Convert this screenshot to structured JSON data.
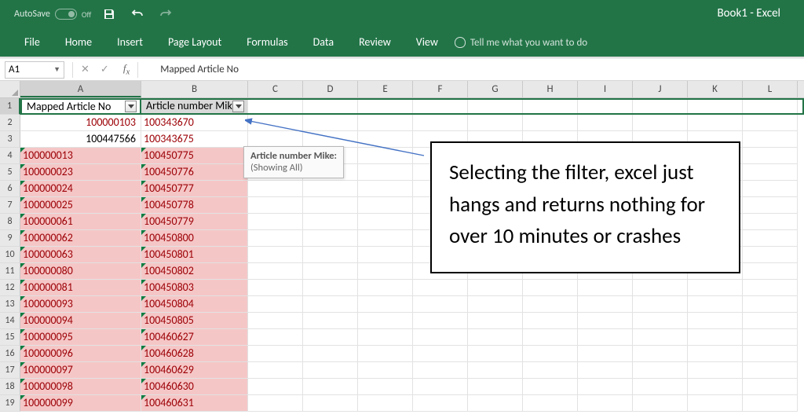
{
  "titlebar": {
    "autosave_label": "AutoSave",
    "autosave_state": "Off",
    "title": "Book1  -  Excel"
  },
  "tabs": [
    "File",
    "Home",
    "Insert",
    "Page Layout",
    "Formulas",
    "Data",
    "Review",
    "View"
  ],
  "tellme": "Tell me what you want to do",
  "namebox": "A1",
  "formula": "Mapped Article No",
  "columns": [
    "A",
    "B",
    "C",
    "D",
    "E",
    "F",
    "G",
    "H",
    "I",
    "J",
    "K",
    "L"
  ],
  "header_row": {
    "a": "Mapped Article No",
    "b": "Article number Mik"
  },
  "rows": [
    {
      "n": 2,
      "a": "100000103",
      "b": "100343670",
      "apink": false,
      "bpink": false
    },
    {
      "n": 3,
      "a": "100447566",
      "b": "100343675",
      "apink": false,
      "bpink": false,
      "ablack": true
    },
    {
      "n": 4,
      "a": "100000013",
      "b": "100450775",
      "apink": true,
      "bpink": true
    },
    {
      "n": 5,
      "a": "100000023",
      "b": "100450776",
      "apink": true,
      "bpink": true
    },
    {
      "n": 6,
      "a": "100000024",
      "b": "100450777",
      "apink": true,
      "bpink": true
    },
    {
      "n": 7,
      "a": "100000025",
      "b": "100450778",
      "apink": true,
      "bpink": true
    },
    {
      "n": 8,
      "a": "100000061",
      "b": "100450779",
      "apink": true,
      "bpink": true
    },
    {
      "n": 9,
      "a": "100000062",
      "b": "100450800",
      "apink": true,
      "bpink": true
    },
    {
      "n": 10,
      "a": "100000063",
      "b": "100450801",
      "apink": true,
      "bpink": true
    },
    {
      "n": 11,
      "a": "100000080",
      "b": "100450802",
      "apink": true,
      "bpink": true
    },
    {
      "n": 12,
      "a": "100000081",
      "b": "100450803",
      "apink": true,
      "bpink": true
    },
    {
      "n": 13,
      "a": "100000093",
      "b": "100450804",
      "apink": true,
      "bpink": true
    },
    {
      "n": 14,
      "a": "100000094",
      "b": "100450805",
      "apink": true,
      "bpink": true
    },
    {
      "n": 15,
      "a": "100000095",
      "b": "100460627",
      "apink": true,
      "bpink": true
    },
    {
      "n": 16,
      "a": "100000096",
      "b": "100460628",
      "apink": true,
      "bpink": true
    },
    {
      "n": 17,
      "a": "100000097",
      "b": "100460629",
      "apink": true,
      "bpink": true
    },
    {
      "n": 18,
      "a": "100000098",
      "b": "100460630",
      "apink": true,
      "bpink": true
    },
    {
      "n": 19,
      "a": "100000099",
      "b": "100460631",
      "apink": true,
      "bpink": true
    }
  ],
  "tooltip": {
    "title": "Article number Mike:",
    "body": "(Showing All)"
  },
  "annotation": "Selecting the filter, excel just hangs and returns nothing for over 10 minutes or crashes"
}
